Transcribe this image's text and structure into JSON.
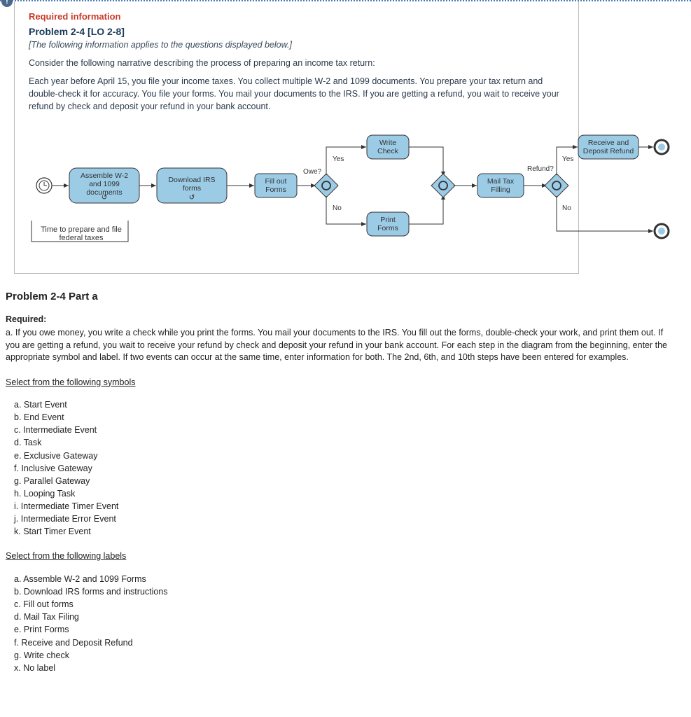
{
  "header": {
    "required_info": "Required information",
    "problem_title": "Problem 2-4 [LO 2-8]",
    "italic_note": "[The following information applies to the questions displayed below.]",
    "narrative1": "Consider the following narrative describing the process of preparing an income tax return:",
    "narrative2": "Each year before April 15, you file your income taxes. You collect multiple W-2 and 1099 documents. You prepare your tax return and double-check it for accuracy. You file your forms. You mail your documents to the IRS. If you are getting a refund, you wait to receive your refund by check and deposit your refund in your bank account."
  },
  "diagram": {
    "lane_label": "Time to prepare and file federal taxes",
    "nodes": {
      "assemble": "Assemble W-2 and 1099 documents",
      "download": "Download IRS forms",
      "fillout": "Fill out Forms",
      "owe": "Owe?",
      "writecheck": "Write Check",
      "printforms": "Print Forms",
      "mailtax": "Mail Tax Filling",
      "refund": "Refund?",
      "receive": "Receive and Deposit Refund",
      "yes": "Yes",
      "no": "No"
    }
  },
  "part": {
    "heading": "Problem 2-4 Part a",
    "required_label": "Required:",
    "required_text": "a. If you owe money, you write a check while you print the forms. You mail your documents to the IRS. You fill out the forms, double-check your work, and print them out. If you are getting a refund, you wait to receive your refund by check and deposit your refund in your bank account. For each step in the diagram from the beginning, enter the appropriate symbol and label. If two events can occur at the same time, enter information for both. The 2nd, 6th, and 10th steps have been entered for examples.",
    "symbols_head": "Select from the following symbols",
    "symbols": [
      "a. Start Event",
      "b. End Event",
      "c. Intermediate Event",
      "d. Task",
      "e. Exclusive Gateway",
      "f. Inclusive Gateway",
      "g. Parallel Gateway",
      "h. Looping Task",
      "i. Intermediate Timer Event",
      "j. Intermediate Error Event",
      "k. Start Timer Event"
    ],
    "labels_head": "Select from the following labels",
    "labels": [
      "a. Assemble W-2 and 1099 Forms",
      "b. Download IRS forms and instructions",
      "c. Fill out forms",
      "d. Mail Tax Filing",
      "e. Print Forms",
      "f. Receive and Deposit Refund",
      "g. Write check",
      "x. No label"
    ]
  },
  "chart_data": {
    "type": "bpmn-flow",
    "lane": "Time to prepare and file federal taxes",
    "nodes": [
      {
        "id": "start",
        "type": "start-timer-event",
        "label": ""
      },
      {
        "id": "assemble",
        "type": "looping-task",
        "label": "Assemble W-2 and 1099 documents"
      },
      {
        "id": "download",
        "type": "looping-task",
        "label": "Download IRS forms"
      },
      {
        "id": "fillout",
        "type": "task",
        "label": "Fill out Forms"
      },
      {
        "id": "owe",
        "type": "inclusive-gateway",
        "label": "Owe?"
      },
      {
        "id": "writecheck",
        "type": "task",
        "label": "Write Check"
      },
      {
        "id": "printforms",
        "type": "task",
        "label": "Print Forms"
      },
      {
        "id": "merge1",
        "type": "inclusive-gateway",
        "label": ""
      },
      {
        "id": "mailtax",
        "type": "task",
        "label": "Mail Tax Filling"
      },
      {
        "id": "refund",
        "type": "inclusive-gateway",
        "label": "Refund?"
      },
      {
        "id": "receive",
        "type": "task",
        "label": "Receive and Deposit Refund"
      },
      {
        "id": "end1",
        "type": "end-event",
        "label": ""
      },
      {
        "id": "end2",
        "type": "end-event",
        "label": ""
      }
    ],
    "edges": [
      {
        "from": "start",
        "to": "assemble"
      },
      {
        "from": "assemble",
        "to": "download"
      },
      {
        "from": "download",
        "to": "fillout"
      },
      {
        "from": "fillout",
        "to": "owe"
      },
      {
        "from": "owe",
        "to": "writecheck",
        "label": "Yes"
      },
      {
        "from": "owe",
        "to": "printforms",
        "label": "No"
      },
      {
        "from": "writecheck",
        "to": "merge1"
      },
      {
        "from": "printforms",
        "to": "merge1"
      },
      {
        "from": "merge1",
        "to": "mailtax"
      },
      {
        "from": "mailtax",
        "to": "refund"
      },
      {
        "from": "refund",
        "to": "receive",
        "label": "Yes"
      },
      {
        "from": "receive",
        "to": "end1"
      },
      {
        "from": "refund",
        "to": "end2",
        "label": "No"
      }
    ]
  }
}
